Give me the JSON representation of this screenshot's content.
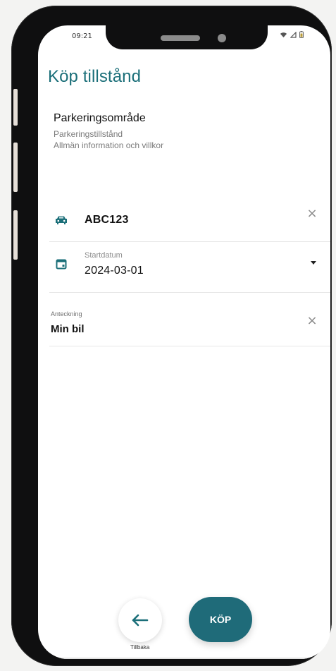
{
  "status_bar": {
    "time": "09:21"
  },
  "page": {
    "title": "Köp tillstånd"
  },
  "area": {
    "title": "Parkeringsområde",
    "subtitle": "Parkeringstillstånd",
    "info_link": "Allmän information och villkor"
  },
  "fields": {
    "plate": {
      "value": "ABC123"
    },
    "start_date": {
      "label": "Startdatum",
      "value": "2024-03-01"
    },
    "note": {
      "label": "Anteckning",
      "value": "Min bil"
    }
  },
  "actions": {
    "back_label": "Tillbaka",
    "buy_label": "KÖP"
  },
  "colors": {
    "accent": "#1b6f79",
    "buy_button": "#1f6b79",
    "text": "#111111",
    "muted": "#7a7a7a"
  },
  "icons": {
    "car": "car-icon",
    "calendar": "calendar-icon",
    "clear": "close-icon",
    "dropdown": "chevron-down-icon",
    "back": "arrow-left-icon"
  }
}
